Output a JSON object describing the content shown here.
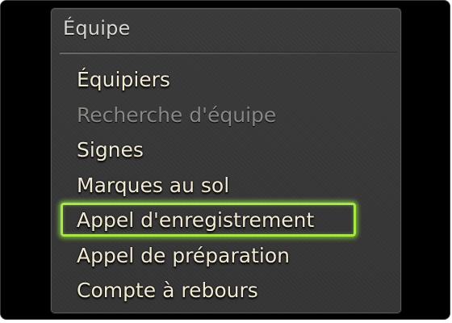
{
  "menu": {
    "title": "Équipe",
    "items": [
      {
        "label": "Équipiers",
        "enabled": true,
        "selected": false
      },
      {
        "label": "Recherche d'équipe",
        "enabled": false,
        "selected": false
      },
      {
        "label": "Signes",
        "enabled": true,
        "selected": false
      },
      {
        "label": "Marques au sol",
        "enabled": true,
        "selected": false
      },
      {
        "label": "Appel d'enregistrement",
        "enabled": true,
        "selected": true
      },
      {
        "label": "Appel de préparation",
        "enabled": true,
        "selected": false
      },
      {
        "label": "Compte à rebours",
        "enabled": true,
        "selected": false
      }
    ]
  },
  "colors": {
    "text": "#f2ead2",
    "disabled_text": "#8a8884",
    "selection_outline": "#a6e84a",
    "menu_background": "#383838"
  }
}
